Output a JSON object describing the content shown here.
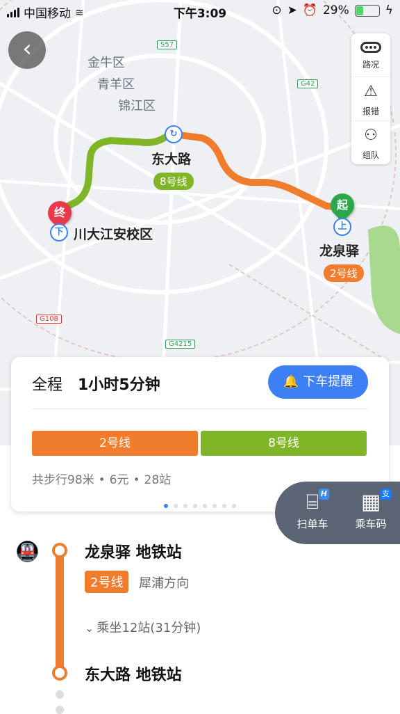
{
  "status_bar": {
    "carrier": "中国移动",
    "time": "下午3:09",
    "battery": "29%",
    "battery_level": 0.29
  },
  "map": {
    "districts": [
      "金牛区",
      "青羊区",
      "锦江区"
    ],
    "road_badges": [
      "S57",
      "G42",
      "G108",
      "G4215"
    ],
    "stations": {
      "start": {
        "name": "龙泉驿",
        "line": "2号线",
        "pin_label": "起",
        "board_icon": "上"
      },
      "transfer": {
        "name": "东大路",
        "line": "8号线"
      },
      "end": {
        "name": "川大江安校区",
        "pin_label": "终",
        "alight_icon": "下"
      }
    },
    "colors": {
      "line2": "#ef7d2d",
      "line8": "#7fb526",
      "start_pin": "#2aa84a",
      "end_pin": "#e83a4a"
    }
  },
  "controls": {
    "traffic": "路况",
    "report": "报错",
    "team": "组队"
  },
  "route_card": {
    "total_label": "全程",
    "total_time": "1小时5分钟",
    "remind_button": "下车提醒",
    "segments": [
      {
        "label": "2号线",
        "color": "#ef7d2d"
      },
      {
        "label": "8号线",
        "color": "#7fb526"
      }
    ],
    "walk": "共步行98米",
    "fare": "6元",
    "stops": "28站",
    "page_count": 8,
    "current_page": 1
  },
  "pay_panel": {
    "scan": "扫单车",
    "scan_badge": "H",
    "code": "乘车码",
    "code_badge": "支"
  },
  "detail": {
    "board_station": "龙泉驿 地铁站",
    "line_badge": "2号线",
    "direction": "犀浦方向",
    "ride_info": "乘坐12站(31分钟)",
    "transfer_station": "东大路 地铁站"
  }
}
